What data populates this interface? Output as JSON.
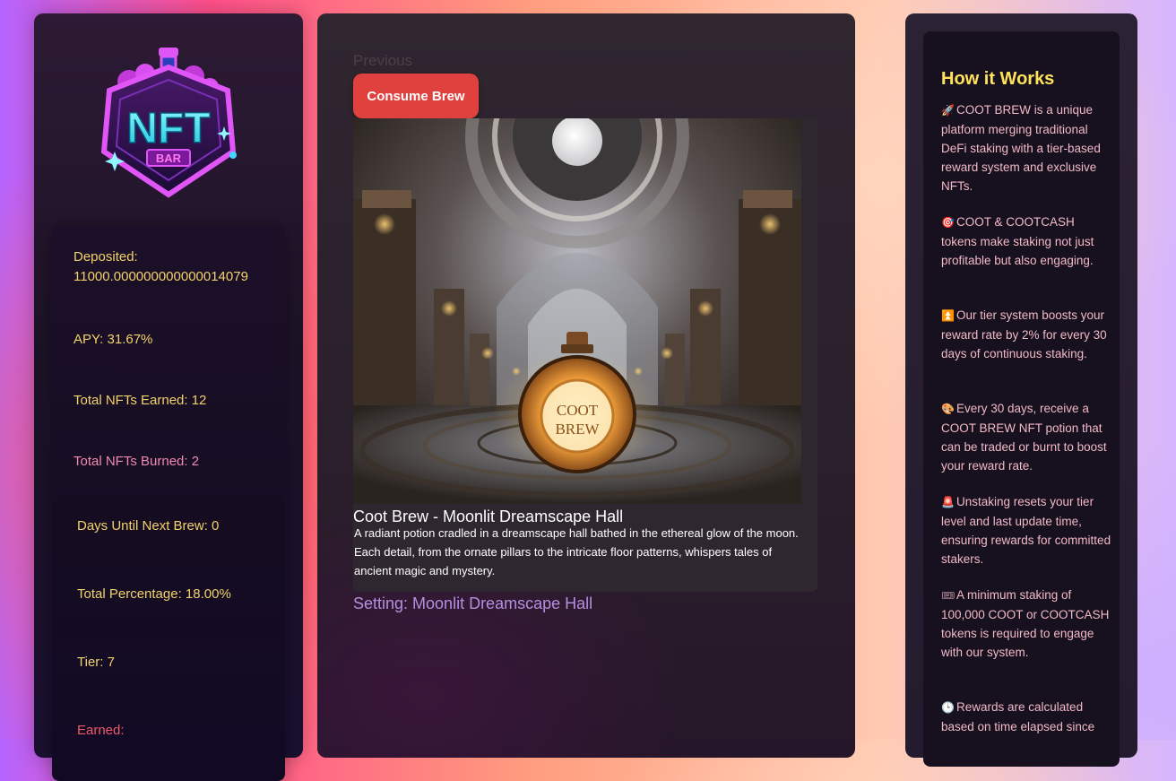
{
  "logo": {
    "text": "NFT",
    "subtext": "BAR"
  },
  "stats": {
    "deposited": "Deposited: 11000.000000000000014079",
    "apy": "APY: 31.67%",
    "total_nfts_earned": "Total NFTs Earned: 12",
    "total_nfts_burned": "Total NFTs Burned: 2",
    "days_until_next_brew": "Days Until Next Brew: 0",
    "total_percentage": "Total Percentage: 18.00%",
    "tier": "Tier: 7",
    "earned": "Earned:"
  },
  "center": {
    "previous_label": "Previous",
    "consume_button_label": "Consume Brew",
    "potion_label_top": "COOT",
    "potion_label_bottom": "BREW",
    "nft_title": "Coot Brew - Moonlit Dreamscape Hall",
    "nft_description": "A radiant potion cradled in a dreamscape hall bathed in the ethereal glow of the moon. Each detail, from the ornate pillars to the intricate floor patterns, whispers tales of ancient magic and mystery.",
    "setting": "Setting: Moonlit Dreamscape Hall"
  },
  "how_it_works": {
    "title": "How it Works",
    "items": [
      {
        "icon": "rocket-icon",
        "glyph": "🚀",
        "text": "COOT BREW is a unique platform merging traditional DeFi staking with a tier-based reward system and exclusive NFTs."
      },
      {
        "icon": "target-icon",
        "glyph": "🎯",
        "text": "COOT & COOTCASH tokens make staking not just profitable but also engaging."
      },
      {
        "icon": "up-arrow-icon",
        "glyph": "⏫",
        "text": "Our tier system boosts your reward rate by 2% for every 30 days of continuous staking."
      },
      {
        "icon": "palette-icon",
        "glyph": "🎨",
        "text": "Every 30 days, receive a COOT BREW NFT potion that can be traded or burnt to boost your reward rate."
      },
      {
        "icon": "siren-icon",
        "glyph": "🚨",
        "text": "Unstaking resets your tier level and last update time, ensuring rewards for committed stakers."
      },
      {
        "icon": "ticket-icon",
        "glyph": "🎟",
        "text": "A minimum staking of 100,000 COOT or COOTCASH tokens is required to engage with our system."
      },
      {
        "icon": "clock-icon",
        "glyph": "🕒",
        "text": "Rewards are calculated based on time elapsed since"
      }
    ]
  },
  "colors": {
    "accent_yellow": "#ffe35a",
    "stat_text": "#f2d36b",
    "burned_text": "#f08ab0",
    "earned_text": "#ef5a6a",
    "consume_button": "#e0413e",
    "setting_text": "#b58ee0",
    "how_text": "#f3b9c6"
  }
}
